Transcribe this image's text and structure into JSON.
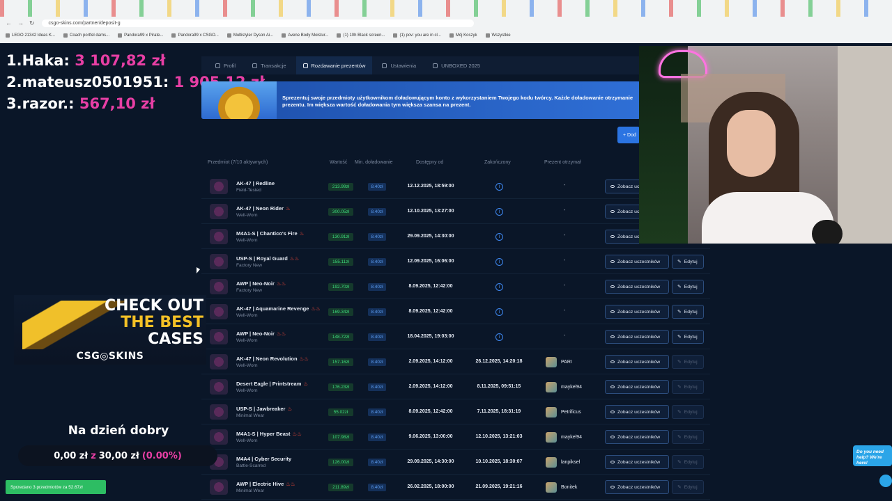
{
  "browser": {
    "url": "csgo-skins.com/partner/deposit-g",
    "bookmarks": [
      "LEGO 21342 Ideas K...",
      "Coach portfel dams...",
      "Pandora99 x Pirate...",
      "Pandora99 x CSGO...",
      "Multistyler Dyson Ai...",
      "Avene Body Moistur...",
      "(1) 10h Black screen...",
      "(1) pov: you are in cl...",
      "Mój Koszyk",
      "Wszystkie"
    ]
  },
  "leaderboard": [
    {
      "rank": "1.",
      "name": "Haka:",
      "amount": "3 107,82 zł"
    },
    {
      "rank": "2.",
      "name": "mateusz0501951:",
      "amount": "1 905,12 zł"
    },
    {
      "rank": "3.",
      "name": "razor.:",
      "amount": "567,10 zł"
    }
  ],
  "tabs": [
    {
      "label": "Profil",
      "active": false
    },
    {
      "label": "Transakcje",
      "active": false
    },
    {
      "label": "Rozdawanie prezentów",
      "active": true
    },
    {
      "label": "Ustawienia",
      "active": false
    },
    {
      "label": "UNBOXED 2025",
      "active": false
    }
  ],
  "banner": {
    "text": "Sprezentuj swoje przedmioty użytkownikom doładowującym konto z wykorzystaniem Twojego kodu twórcy. Każde doładowanie otrzymanie prezentu. Im większa wartość doładowania tym większa szansa na prezent."
  },
  "add_button": "+ Dod",
  "table": {
    "headers": {
      "item": "Przedmiot (7/10 aktywnych)",
      "value": "Wartość",
      "min": "Min. doładowanie",
      "from": "Dostępny od",
      "ended": "Zakończony",
      "winner": "Prezent otrzymał"
    },
    "see_label": "Zobacz uczestników",
    "edit_label": "Edytuj",
    "rows": [
      {
        "name": "AK-47 | Redline",
        "fire": "",
        "cond": "Field-Tested",
        "value": "213.99zł",
        "min": "8.40zł",
        "from": "12.12.2025, 18:59:00",
        "ended": "",
        "winner": "-"
      },
      {
        "name": "AK-47 | Neon Rider",
        "fire": "♨",
        "cond": "Well-Worn",
        "value": "300.05zł",
        "min": "8.40zł",
        "from": "12.10.2025, 13:27:00",
        "ended": "",
        "winner": "-"
      },
      {
        "name": "M4A1-S | Chantico's Fire",
        "fire": "♨",
        "cond": "Well-Worn",
        "value": "130.91zł",
        "min": "8.40zł",
        "from": "29.09.2025, 14:30:00",
        "ended": "",
        "winner": "-"
      },
      {
        "name": "USP-S | Royal Guard",
        "fire": "♨♨",
        "cond": "Factory New",
        "value": "155.11zł",
        "min": "8.40zł",
        "from": "12.09.2025, 16:06:00",
        "ended": "",
        "winner": "-"
      },
      {
        "name": "AWP | Neo-Noir",
        "fire": "♨♨",
        "cond": "Factory New",
        "value": "192.70zł",
        "min": "8.40zł",
        "from": "8.09.2025, 12:42:00",
        "ended": "",
        "winner": "-"
      },
      {
        "name": "AK-47 | Aquamarine Revenge",
        "fire": "♨♨",
        "cond": "Well-Worn",
        "value": "169.34zł",
        "min": "8.40zł",
        "from": "8.09.2025, 12:42:00",
        "ended": "",
        "winner": "-"
      },
      {
        "name": "AWP | Neo-Noir",
        "fire": "♨♨",
        "cond": "Well-Worn",
        "value": "148.72zł",
        "min": "8.40zł",
        "from": "18.04.2025, 19:03:00",
        "ended": "",
        "winner": "-"
      },
      {
        "name": "AK-47 | Neon Revolution",
        "fire": "♨♨",
        "cond": "Well-Worn",
        "value": "157.16zł",
        "min": "8.40zł",
        "from": "2.09.2025, 14:12:00",
        "ended": "26.12.2025, 14:20:18",
        "winner": "PARI"
      },
      {
        "name": "Desert Eagle | Printstream",
        "fire": "♨",
        "cond": "Well-Worn",
        "value": "176.23zł",
        "min": "8.40zł",
        "from": "2.09.2025, 14:12:00",
        "ended": "8.11.2025, 09:51:15",
        "winner": "maykel94"
      },
      {
        "name": "USP-S | Jawbreaker",
        "fire": "♨",
        "cond": "Minimal Wear",
        "value": "55.02zł",
        "min": "8.40zł",
        "from": "8.09.2025, 12:42:00",
        "ended": "7.11.2025, 18:31:19",
        "winner": "Petrificus"
      },
      {
        "name": "M4A1-S | Hyper Beast",
        "fire": "♨♨",
        "cond": "Well-Worn",
        "value": "107.98zł",
        "min": "8.40zł",
        "from": "9.06.2025, 13:00:00",
        "ended": "12.10.2025, 13:21:03",
        "winner": "maykel94"
      },
      {
        "name": "M4A4 | Cyber Security",
        "fire": "",
        "cond": "Battle-Scarred",
        "value": "126.00zł",
        "min": "8.40zł",
        "from": "29.09.2025, 14:30:00",
        "ended": "10.10.2025, 18:30:07",
        "winner": "lanpiksel"
      },
      {
        "name": "AWP | Electric Hive",
        "fire": "♨♨",
        "cond": "Minimal Wear",
        "value": "211.89zł",
        "min": "8.40zł",
        "from": "26.02.2025, 18:00:00",
        "ended": "21.09.2025, 19:21:16",
        "winner": "Bonitek"
      }
    ]
  },
  "promo": {
    "line1": "CHECK OUT",
    "line2": "THE BEST",
    "line3": "CASES",
    "brand": "CSG◎SKINS"
  },
  "goal": {
    "title": "Na dzień dobry",
    "current": "0,00 zł",
    "sep": "z",
    "target": "30,00 zł",
    "percent": "(0.00%)"
  },
  "toast": "Sprzedano 3 przedmiotów za 52.67zł",
  "help": "Do you need help? We're here!"
}
